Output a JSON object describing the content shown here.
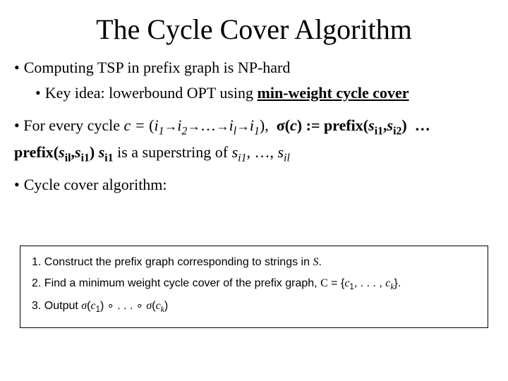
{
  "title": "The Cycle Cover Algorithm",
  "b1": "Computing TSP in prefix graph is NP-hard",
  "b2_pre": "Key idea: lowerbound OPT using ",
  "b2_bold": "min-weight cycle cover",
  "b4": "Cycle cover algorithm:",
  "algo": {
    "s1_pre": "1.   Construct the prefix graph corresponding to strings in ",
    "s1_S": "S",
    "s1_post": ".",
    "s2_pre": "2.   Find a minimum weight cycle cover of the prefix graph, ",
    "s2_C": "C",
    "s2_eq": " = {",
    "s2_c": "c",
    "s2_1": "1",
    "s2_mid": ", . . . , ",
    "s2_k": "k",
    "s2_end": "}.",
    "s3_pre": "3.   Output ",
    "s3_sig": "σ",
    "s3_op": "(",
    "s3_cp": ")",
    "s3_circ": " ∘ . . . ∘ ",
    "s3_k": "k"
  }
}
